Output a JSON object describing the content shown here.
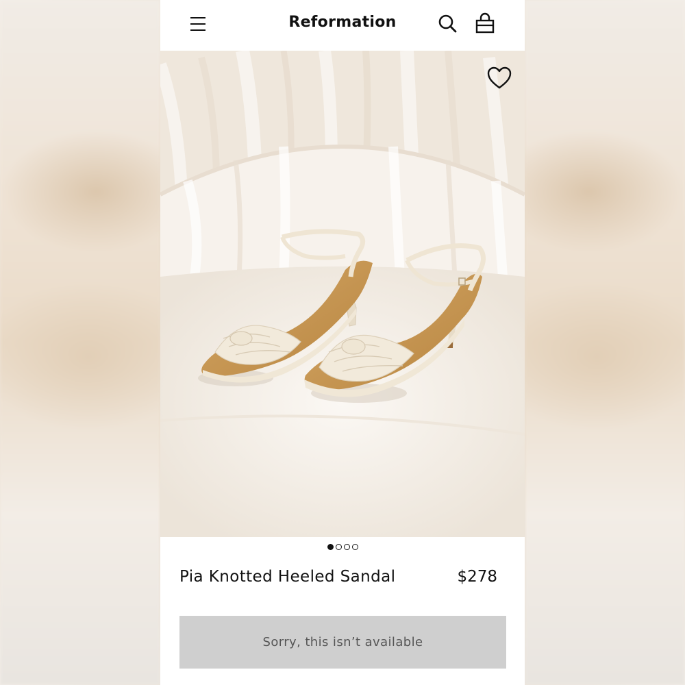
{
  "header": {
    "brand": "Reformation",
    "menu_icon": "hamburger-menu-icon",
    "search_icon": "search-icon",
    "bag_icon": "shopping-bag-icon"
  },
  "product": {
    "name": "Pia Knotted Heeled Sandal",
    "price": "$278",
    "availability_button": "Sorry, this isn’t available",
    "favorite_icon": "heart-icon",
    "gallery": {
      "total_images": 4,
      "current_index": 1
    }
  },
  "colors": {
    "text": "#111111",
    "button_bg": "#cfcfcf",
    "button_text": "#555555",
    "shoe_cream": "#efe6d4",
    "insole_tan": "#c79752"
  }
}
